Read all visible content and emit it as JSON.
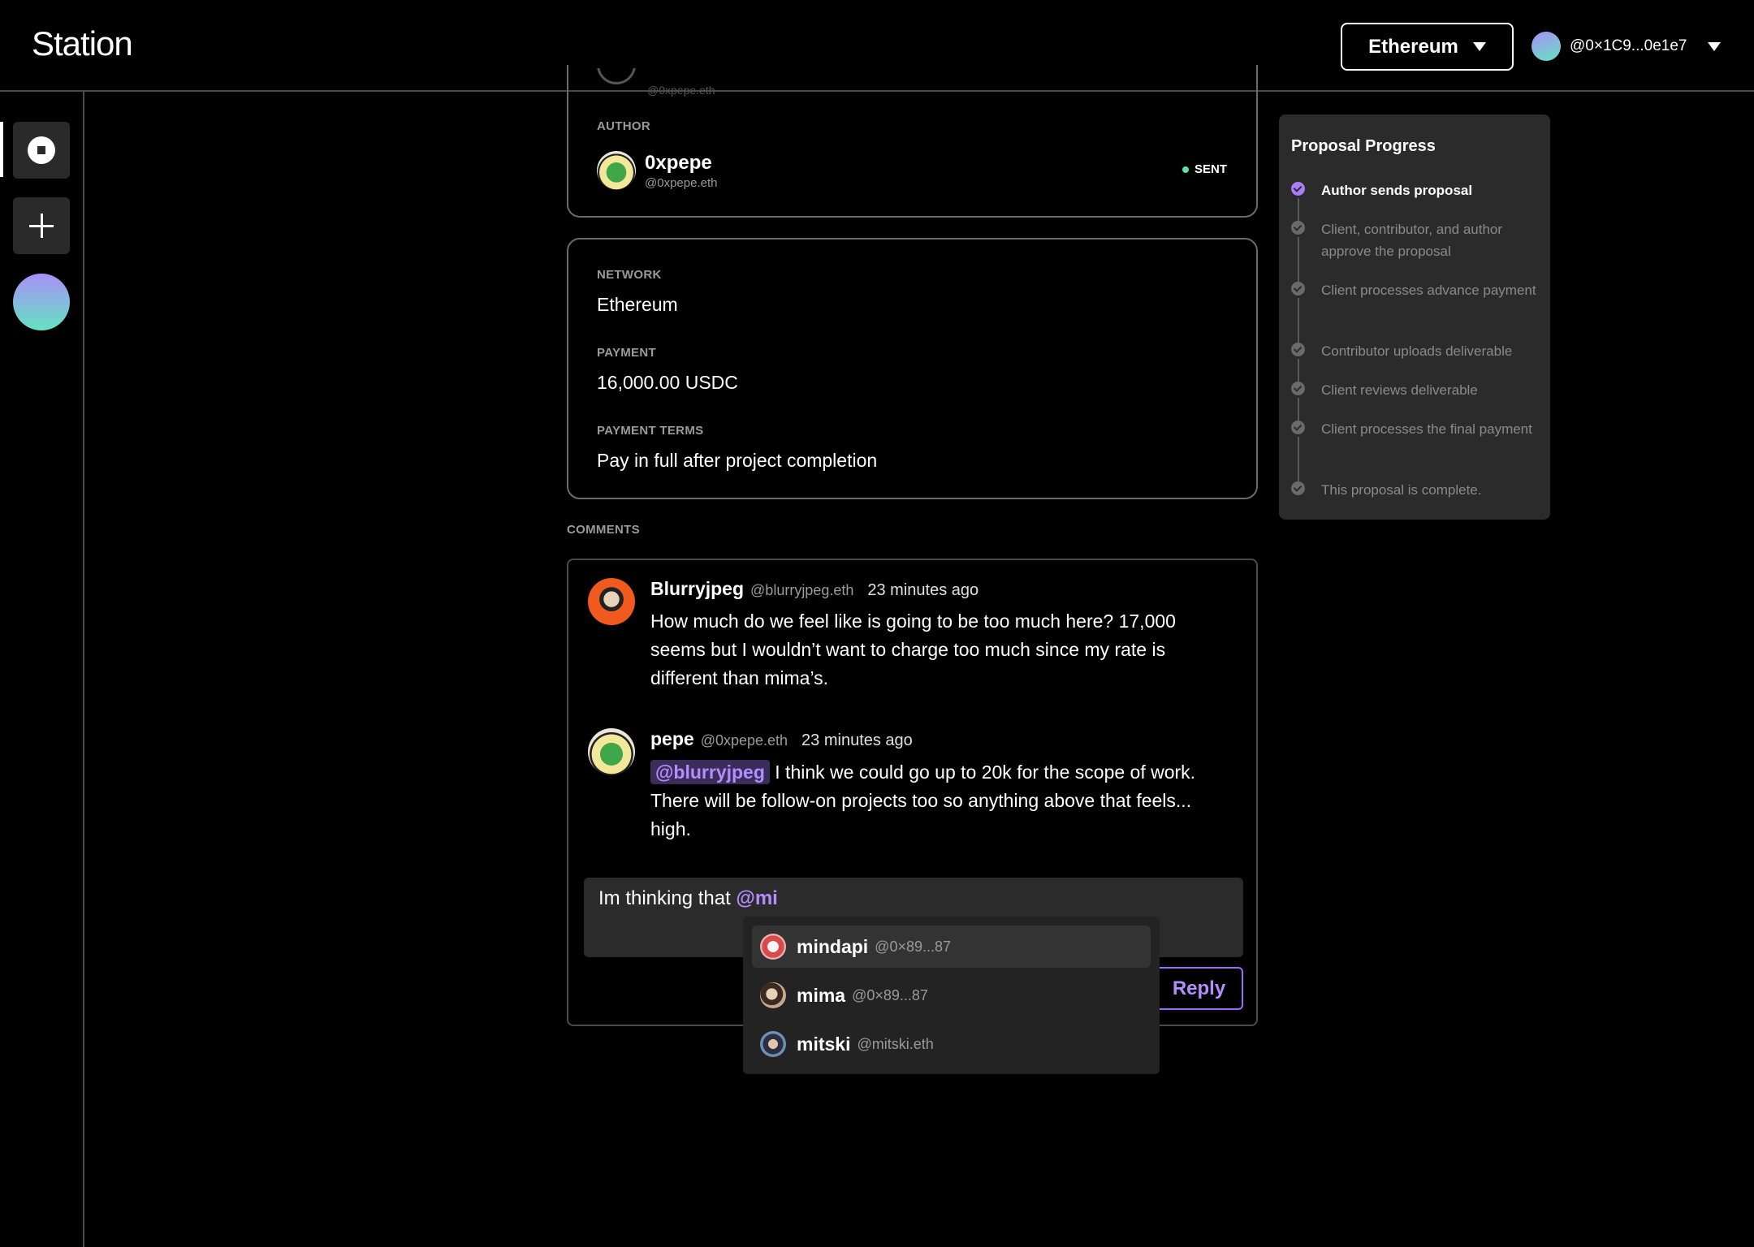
{
  "header": {
    "logo": "Station",
    "network": "Ethereum",
    "account": "@0×1C9...0e1e7"
  },
  "author_card": {
    "peek_handle": "@0xpepe.eth",
    "label": "AUTHOR",
    "name": "0xpepe",
    "handle": "@0xpepe.eth",
    "status": "SENT"
  },
  "terms": {
    "network_label": "NETWORK",
    "network_value": "Ethereum",
    "payment_label": "PAYMENT",
    "payment_value": "16,000.00 USDC",
    "terms_label": "PAYMENT TERMS",
    "terms_value": "Pay in full after project completion"
  },
  "comments": {
    "label": "COMMENTS",
    "items": [
      {
        "name": "Blurryjpeg",
        "handle": "@blurryjpeg.eth",
        "time": "23 minutes ago",
        "body": "How much do we feel like is going to be too much here? 17,000 seems but I wouldn’t want to charge too much since my rate is different than mima’s."
      },
      {
        "name": "pepe",
        "handle": "@0xpepe.eth",
        "time": "23 minutes ago",
        "mention": "@blurryjpeg",
        "body": " I think we could go up to 20k for the scope of work. There will be follow-on projects too so anything above that feels... high."
      }
    ],
    "draft_text": "Im thinking that ",
    "draft_mention": "@mi",
    "reply_label": "Reply"
  },
  "mention_suggestions": [
    {
      "name": "mindapi",
      "handle": "@0×89...87"
    },
    {
      "name": "mima",
      "handle": "@0×89...87"
    },
    {
      "name": "mitski",
      "handle": "@mitski.eth"
    }
  ],
  "progress": {
    "title": "Proposal Progress",
    "steps": [
      {
        "text": "Author sends proposal",
        "done": true
      },
      {
        "text": "Client, contributor, and author approve the proposal",
        "done": false
      },
      {
        "text": "Client processes advance payment",
        "done": false
      },
      {
        "text": "Contributor uploads deliverable",
        "done": false
      },
      {
        "text": "Client reviews deliverable",
        "done": false
      },
      {
        "text": "Client processes the final payment",
        "done": false
      },
      {
        "text": "This proposal is complete.",
        "done": false
      }
    ]
  },
  "colors": {
    "accent": "#a97cf8",
    "status_sent": "#5de3a1"
  }
}
